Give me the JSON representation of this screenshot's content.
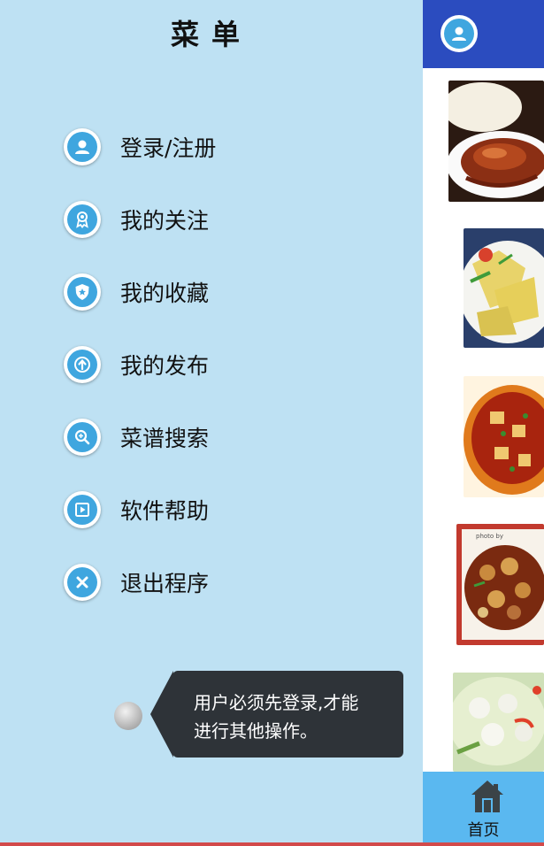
{
  "drawer": {
    "title": "菜单",
    "items": [
      {
        "label": "登录/注册",
        "icon": "user-icon"
      },
      {
        "label": "我的关注",
        "icon": "badge-icon"
      },
      {
        "label": "我的收藏",
        "icon": "shield-star-icon"
      },
      {
        "label": "我的发布",
        "icon": "upload-icon"
      },
      {
        "label": "菜谱搜索",
        "icon": "search-icon"
      },
      {
        "label": "软件帮助",
        "icon": "play-book-icon"
      },
      {
        "label": "退出程序",
        "icon": "close-icon"
      }
    ]
  },
  "toast": {
    "line1": "用户必须先登录,才能",
    "line2": "进行其他操作。"
  },
  "bottom_nav": {
    "home_label": "首页",
    "home_icon": "home-icon"
  },
  "colors": {
    "drawer_bg": "#bee1f3",
    "topbar": "#2b4cbf",
    "icon_accent": "#3fa6df",
    "bottombar": "#5ab8f0",
    "toast_bg": "#2e3338"
  }
}
